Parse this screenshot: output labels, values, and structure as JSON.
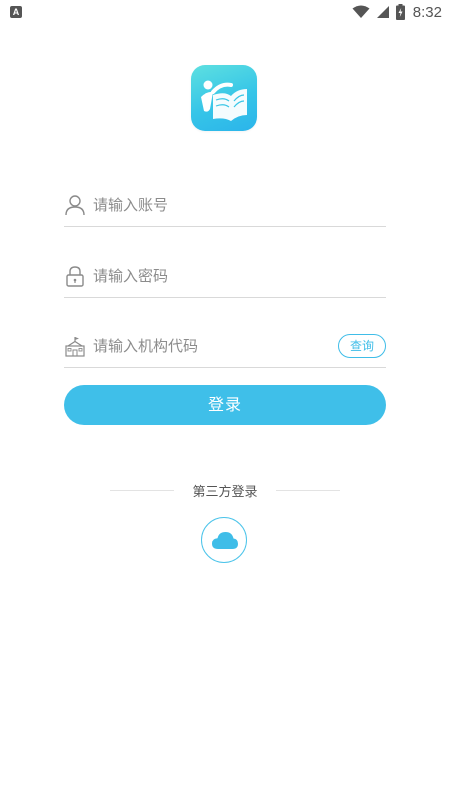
{
  "status_bar": {
    "left_icon": "A",
    "time": "8:32",
    "icons": [
      "wifi-icon",
      "cell-signal-icon",
      "battery-charging-icon"
    ]
  },
  "app": {
    "logo_icon": "app-logo-book-icon",
    "brand_color": "#3fbfe9"
  },
  "form": {
    "account": {
      "icon": "user-icon",
      "placeholder": "请输入账号",
      "value": ""
    },
    "password": {
      "icon": "lock-icon",
      "placeholder": "请输入密码",
      "value": ""
    },
    "org_code": {
      "icon": "school-building-icon",
      "placeholder": "请输入机构代码",
      "value": "",
      "query_label": "查询"
    },
    "login_label": "登录"
  },
  "third_party": {
    "label": "第三方登录",
    "providers": [
      "cloud-icon"
    ]
  }
}
